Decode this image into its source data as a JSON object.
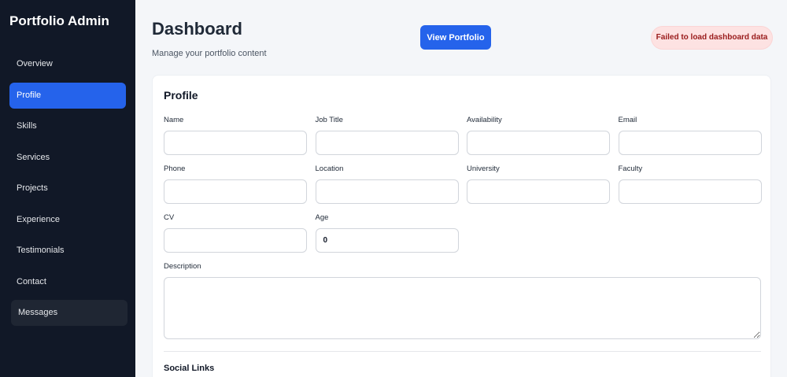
{
  "sidebar": {
    "brand": "Portfolio Admin",
    "items": [
      {
        "label": "Overview"
      },
      {
        "label": "Profile"
      },
      {
        "label": "Skills"
      },
      {
        "label": "Services"
      },
      {
        "label": "Projects"
      },
      {
        "label": "Experience"
      },
      {
        "label": "Testimonials"
      },
      {
        "label": "Contact"
      },
      {
        "label": "Messages"
      }
    ],
    "active_item": "Profile"
  },
  "header": {
    "title": "Dashboard",
    "subtitle": "Manage your portfolio content",
    "view_button": "View Portfolio",
    "error_message": "Failed to load dashboard data"
  },
  "profile": {
    "title": "Profile",
    "fields": {
      "name": {
        "label": "Name",
        "value": ""
      },
      "job_title": {
        "label": "Job Title",
        "value": ""
      },
      "availability": {
        "label": "Availability",
        "value": ""
      },
      "email": {
        "label": "Email",
        "value": ""
      },
      "phone": {
        "label": "Phone",
        "value": ""
      },
      "location": {
        "label": "Location",
        "value": ""
      },
      "university": {
        "label": "University",
        "value": ""
      },
      "faculty": {
        "label": "Faculty",
        "value": ""
      },
      "cv": {
        "label": "CV",
        "value": ""
      },
      "age": {
        "label": "Age",
        "value": "0"
      },
      "description": {
        "label": "Description",
        "value": ""
      }
    },
    "social_links_title": "Social Links"
  },
  "colors": {
    "sidebar_bg": "#111827",
    "accent": "#2563eb",
    "error_bg": "#fde2e2",
    "error_text": "#991b1b"
  }
}
